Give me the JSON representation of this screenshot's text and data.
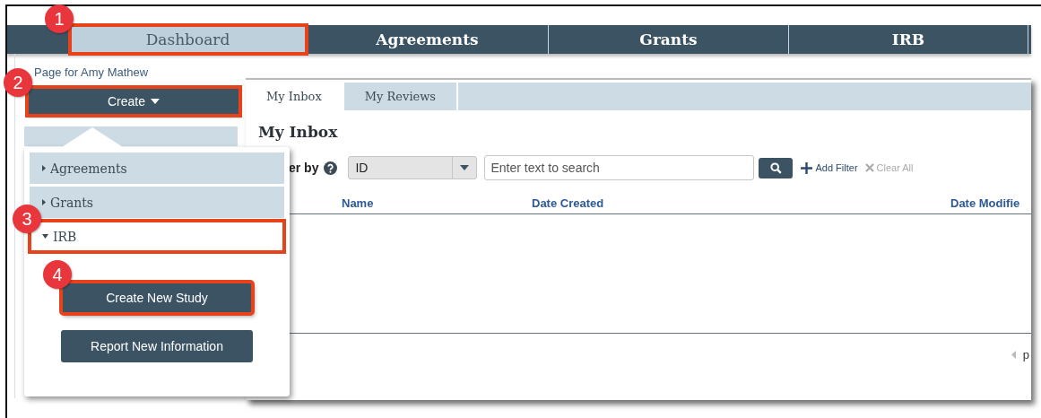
{
  "nav_tabs": [
    {
      "label": "Dashboard",
      "selected": true,
      "callout": "1"
    },
    {
      "label": "Agreements",
      "selected": false
    },
    {
      "label": "Grants",
      "selected": false
    },
    {
      "label": "IRB",
      "selected": false
    }
  ],
  "sidebar": {
    "page_link": "Page for Amy Mathew",
    "create_button": {
      "label": "Create",
      "callout": "2"
    },
    "create_menu": [
      {
        "label": "Agreements",
        "expanded": false
      },
      {
        "label": "Grants",
        "expanded": false
      },
      {
        "label": "IRB",
        "expanded": true,
        "callout": "3",
        "actions": [
          {
            "label": "Create New Study",
            "callout": "4"
          },
          {
            "label": "Report New Information"
          }
        ]
      }
    ]
  },
  "inbox": {
    "tabs": [
      {
        "label": "My Inbox",
        "selected": true
      },
      {
        "label": "My Reviews",
        "selected": false
      }
    ],
    "heading": "My Inbox",
    "filter": {
      "label": "er by",
      "field": "ID",
      "search_placeholder": "Enter text to search",
      "add_filter": "Add Filter",
      "clear_all": {
        "label": "Clear All",
        "disabled": true
      }
    },
    "columns": [
      "Name",
      "Date Created",
      "Date Modifie"
    ],
    "pager": "p"
  }
}
